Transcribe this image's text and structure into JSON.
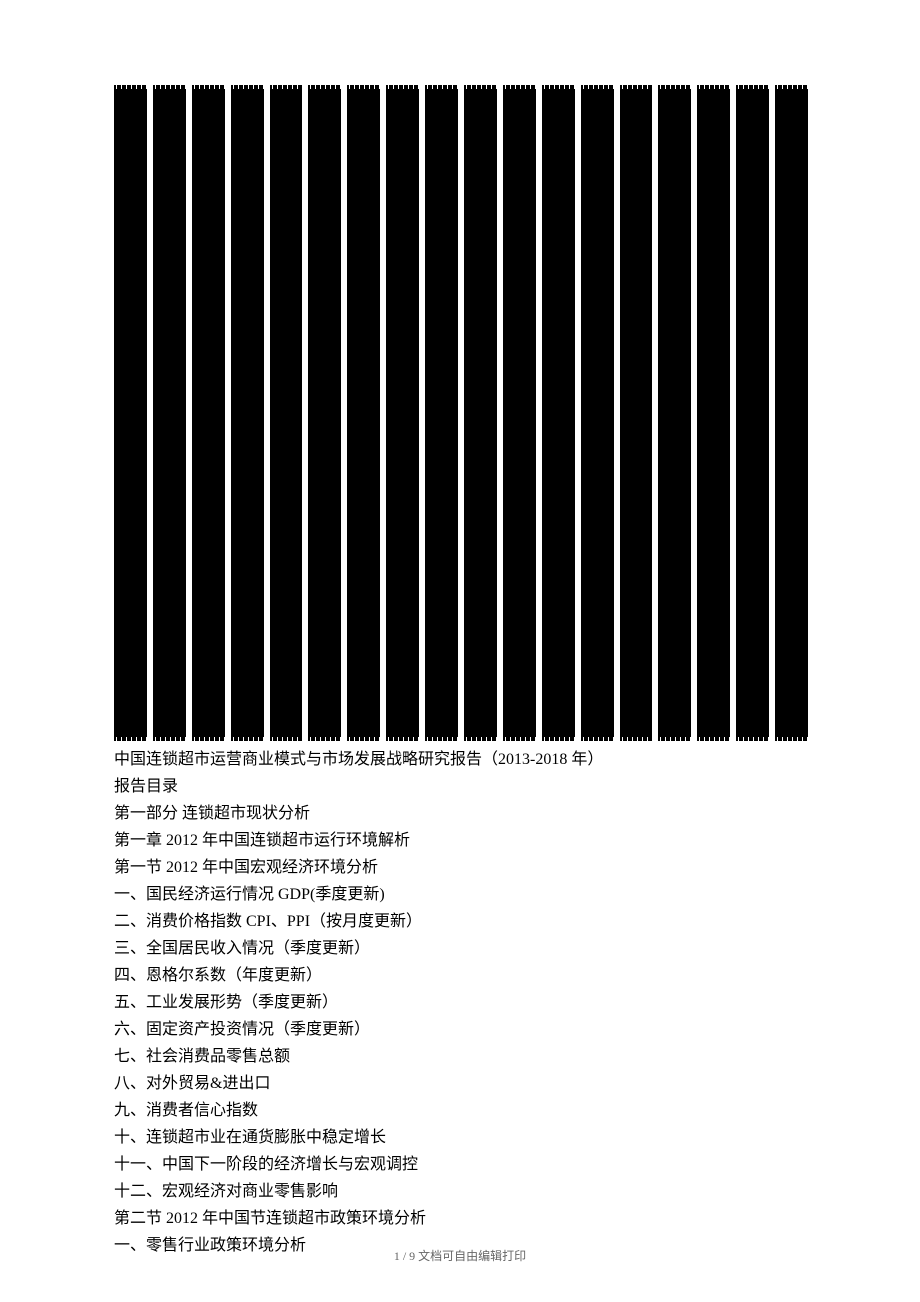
{
  "report": {
    "title": "中国连锁超市运营商业模式与市场发展战略研究报告（2013-2018 年）",
    "toc_label": "报告目录",
    "part1": {
      "heading": "第一部分  连锁超市现状分析",
      "chapter1": {
        "heading": "第一章  2012 年中国连锁超市运行环境解析",
        "section1": {
          "heading": "第一节    2012 年中国宏观经济环境分析",
          "items": [
            "一、国民经济运行情况 GDP(季度更新)",
            "二、消费价格指数 CPI、PPI（按月度更新）",
            "三、全国居民收入情况（季度更新）",
            "四、恩格尔系数（年度更新）",
            "五、工业发展形势（季度更新）",
            "六、固定资产投资情况（季度更新）",
            "七、社会消费品零售总额",
            "八、对外贸易&进出口",
            "九、消费者信心指数",
            "十、连锁超市业在通货膨胀中稳定增长",
            "十一、中国下一阶段的经济增长与宏观调控",
            "十二、宏观经济对商业零售影响"
          ]
        },
        "section2": {
          "heading": "第二节 2012 年中国节连锁超市政策环境分析",
          "items": [
            "一、零售行业政策环境分析"
          ]
        }
      }
    }
  },
  "footer": {
    "page_current": "1",
    "page_sep": " / ",
    "page_total": "9",
    "note": " 文档可自由编辑打印"
  }
}
